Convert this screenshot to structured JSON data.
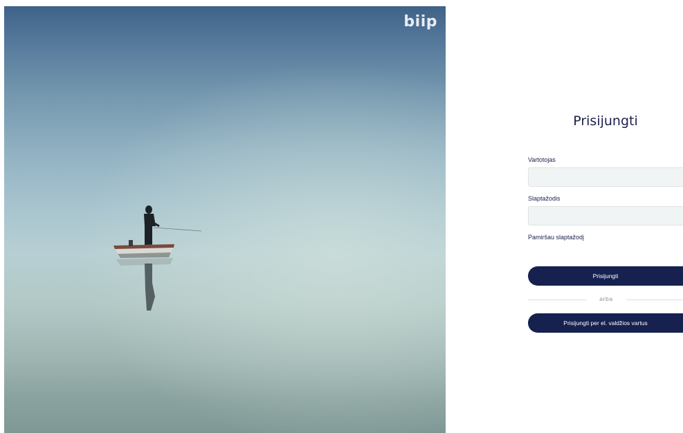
{
  "brand": {
    "logo_text": "biip"
  },
  "login": {
    "title": "Prisijungti",
    "username_label": "Vartotojas",
    "username_value": "",
    "password_label": "Slaptažodis",
    "password_value": "",
    "forgot_password": "Pamiršau slaptažodį",
    "submit_label": "Prisijungti",
    "divider_text": "arba",
    "gov_login_label": "Prisijungti per el. valdžios vartus"
  },
  "colors": {
    "primary": "#162150",
    "input_bg": "#f1f4f4",
    "text": "#1b1f4b"
  }
}
